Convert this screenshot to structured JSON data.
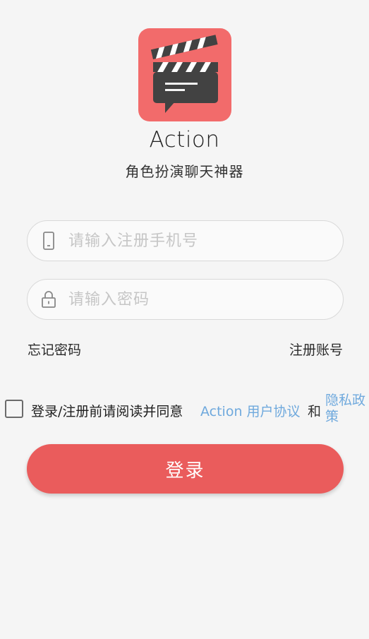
{
  "app": {
    "name": "Action",
    "subtitle": "角色扮演聊天神器",
    "logo_icon": "clapperboard-chat-icon"
  },
  "form": {
    "phone_placeholder": "请输入注册手机号",
    "phone_value": "",
    "phone_icon": "phone-icon",
    "password_placeholder": "请输入密码",
    "password_value": "",
    "password_icon": "lock-icon"
  },
  "links": {
    "forgot_password": "忘记密码",
    "register_account": "注册账号"
  },
  "agreement": {
    "checked": false,
    "prefix": "登录/注册前请阅读并同意",
    "user_agreement": "Action 用户协议",
    "and": "和",
    "privacy_policy": "隐私政策"
  },
  "buttons": {
    "login": "登录"
  },
  "colors": {
    "background": "#f5f5f5",
    "brand_red": "#ea5c5c",
    "logo_red": "#f26b6b",
    "link_blue": "#6fa9dd",
    "placeholder": "#c6c6c6"
  }
}
